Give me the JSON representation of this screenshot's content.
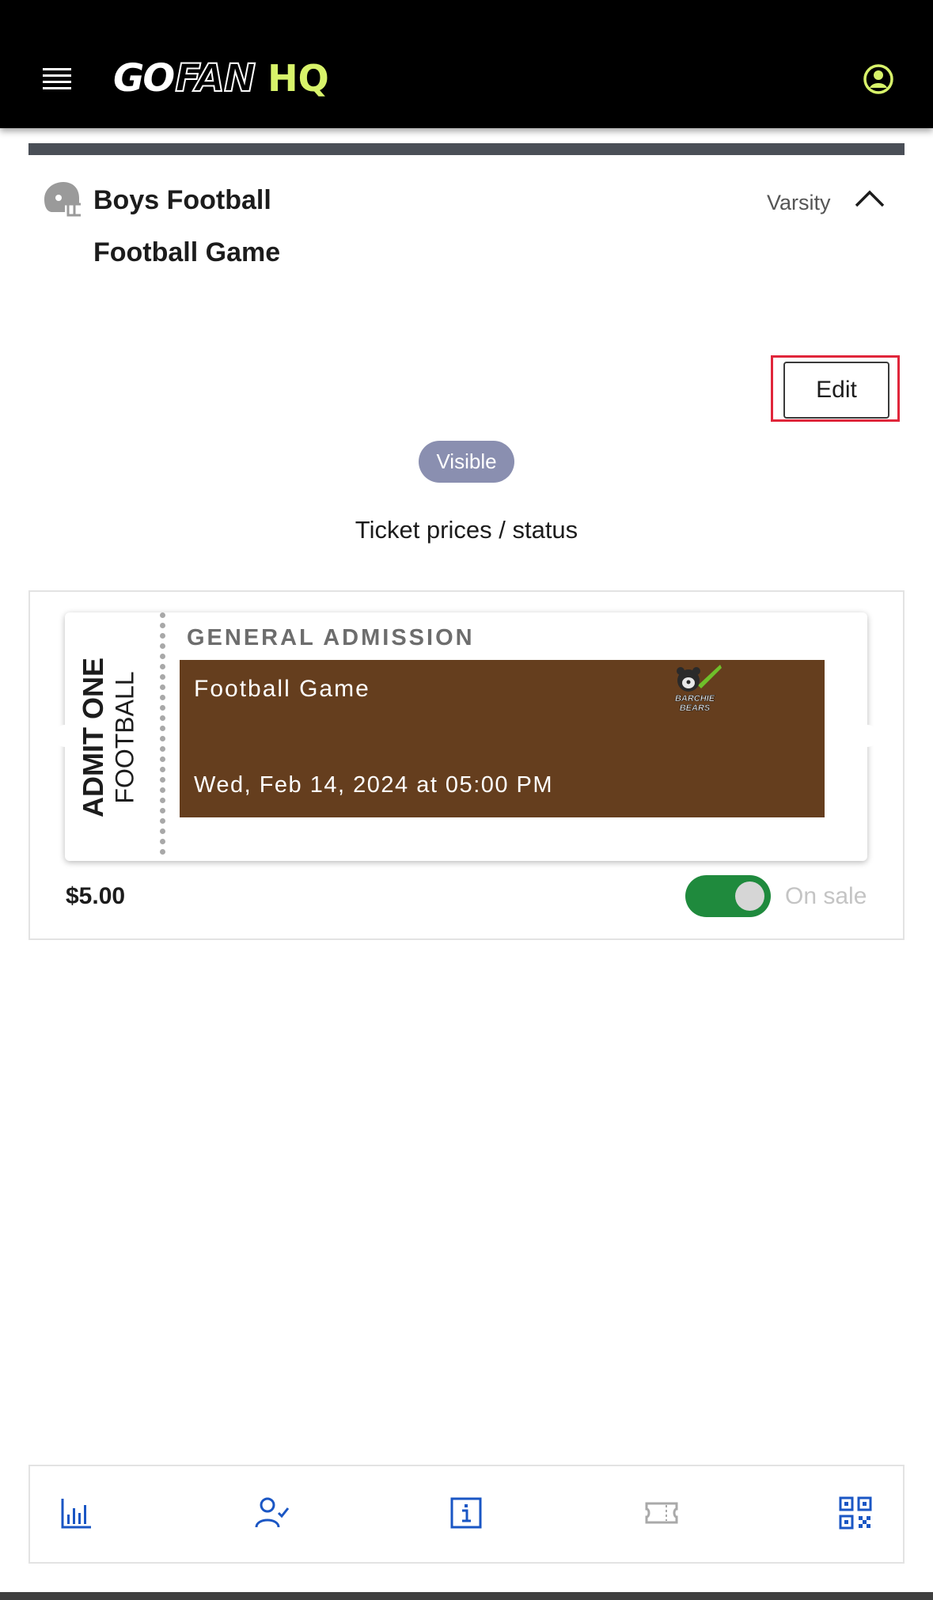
{
  "app": {
    "logo_go": "GO",
    "logo_fan": "FAN",
    "logo_hq": "HQ"
  },
  "event": {
    "sport": "Boys Football",
    "name": "Football Game",
    "level": "Varsity",
    "edit_label": "Edit",
    "visibility_badge": "Visible",
    "section_heading": "Ticket prices / status"
  },
  "ticket": {
    "stub_primary": "ADMIT ONE",
    "stub_secondary": "FOOTBALL",
    "type": "GENERAL ADMISSION",
    "title": "Football Game",
    "datetime": "Wed, Feb 14, 2024 at 05:00 PM",
    "team_logo_text": "BARCHIE BEARS",
    "price": "$5.00",
    "on_sale": true,
    "status_label": "On sale",
    "banner_color": "#653e1e"
  },
  "nav": {
    "items": [
      {
        "name": "stats",
        "icon": "bar-chart-icon"
      },
      {
        "name": "check-in",
        "icon": "user-check-icon"
      },
      {
        "name": "info",
        "icon": "info-icon"
      },
      {
        "name": "tickets",
        "icon": "ticket-icon"
      },
      {
        "name": "scan",
        "icon": "qr-code-icon"
      }
    ]
  },
  "colors": {
    "brand_accent": "#d8f36a",
    "toggle_on": "#1f8a3d",
    "nav_icon": "#1a56c4",
    "highlight": "#e0263b"
  }
}
